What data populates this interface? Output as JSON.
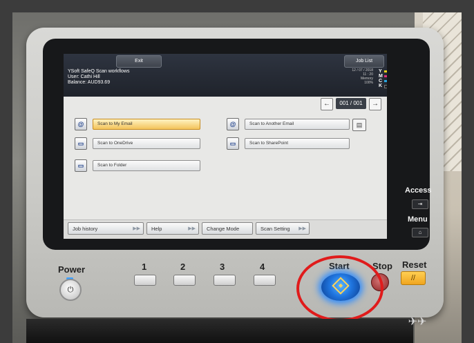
{
  "screen": {
    "top_tabs": {
      "exit": "Exit",
      "job_list": "Job List"
    },
    "header_info": {
      "title": "YSoft SafeQ Scan workflows",
      "user": "User: Cathi Hill",
      "balance": "Balance: AUD93.69"
    },
    "status": {
      "date": "12 / 07 / 2018",
      "time": "11 : 20",
      "memory_label": "Memory",
      "memory_value": "100%",
      "toner": [
        "Y",
        "M",
        "C",
        "K"
      ]
    },
    "pager": {
      "prev_label": "←",
      "count": "001 / 001",
      "next_label": "→"
    },
    "workflows": [
      {
        "label": "Scan to My Email",
        "selected": true,
        "icon": "email-icon"
      },
      {
        "label": "Scan to Another Email",
        "selected": false,
        "icon": "email-icon"
      },
      {
        "label": "Scan to OneDrive",
        "selected": false,
        "icon": "folder-icon"
      },
      {
        "label": "Scan to SharePoint",
        "selected": false,
        "icon": "folder-icon"
      },
      {
        "label": "Scan to Folder",
        "selected": false,
        "icon": "folder-icon"
      }
    ],
    "bottom_bar": {
      "job_history": "Job history",
      "help": "Help",
      "change_mode": "Change Mode",
      "scan_setting": "Scan Setting"
    }
  },
  "panel": {
    "access": "Access",
    "menu": "Menu",
    "power": "Power",
    "numbers": [
      "1",
      "2",
      "3",
      "4"
    ],
    "start": "Start",
    "stop": "Stop",
    "reset": "Reset"
  }
}
